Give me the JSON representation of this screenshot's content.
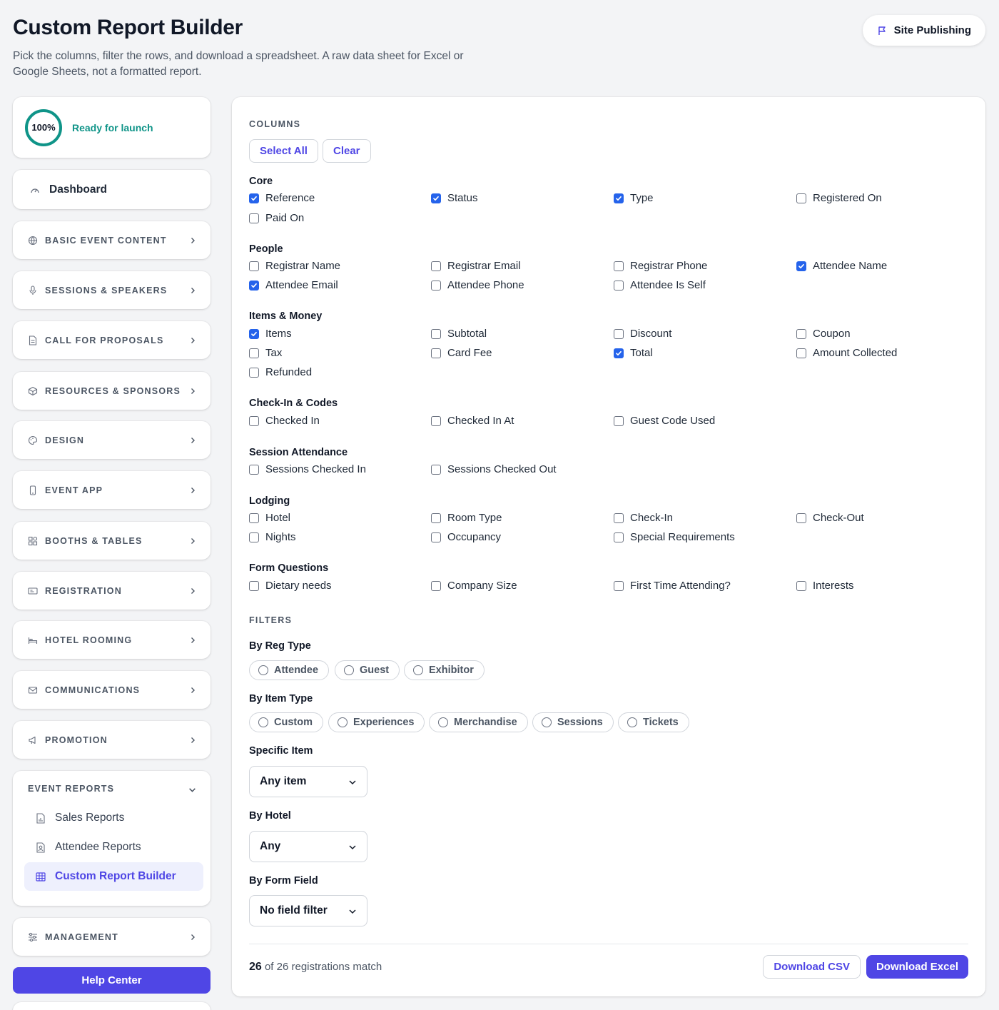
{
  "header": {
    "title": "Custom Report Builder",
    "subtitle": "Pick the columns, filter the rows, and download a spreadsheet. A raw data sheet for Excel or Google Sheets, not a formatted report.",
    "publish_label": "Site Publishing",
    "publish_icon": "flag-icon"
  },
  "sidebar": {
    "launch": {
      "percent": "100%",
      "status": "Ready for launch",
      "progress": 1.0,
      "color": "#0f9488"
    },
    "dashboard": {
      "label": "Dashboard",
      "icon": "gauge-icon"
    },
    "items": [
      {
        "label": "BASIC EVENT CONTENT",
        "icon": "globe-icon"
      },
      {
        "label": "SESSIONS & SPEAKERS",
        "icon": "microphone-icon"
      },
      {
        "label": "CALL FOR PROPOSALS",
        "icon": "document-icon"
      },
      {
        "label": "RESOURCES & SPONSORS",
        "icon": "box-icon"
      },
      {
        "label": "DESIGN",
        "icon": "palette-icon"
      },
      {
        "label": "EVENT APP",
        "icon": "phone-icon"
      },
      {
        "label": "BOOTHS & TABLES",
        "icon": "grid-icon"
      },
      {
        "label": "REGISTRATION",
        "icon": "ticket-icon"
      },
      {
        "label": "HOTEL ROOMING",
        "icon": "bed-icon"
      },
      {
        "label": "COMMUNICATIONS",
        "icon": "mail-icon"
      },
      {
        "label": "PROMOTION",
        "icon": "megaphone-icon"
      }
    ],
    "reports": {
      "label": "EVENT REPORTS",
      "sub": [
        {
          "label": "Sales Reports",
          "icon": "chart-file-icon",
          "active": false
        },
        {
          "label": "Attendee Reports",
          "icon": "person-file-icon",
          "active": false
        },
        {
          "label": "Custom Report Builder",
          "icon": "table-icon",
          "active": true
        }
      ]
    },
    "management": {
      "label": "MANAGEMENT",
      "icon": "sliders-icon"
    },
    "help_label": "Help Center"
  },
  "main": {
    "columns_label": "COLUMNS",
    "select_all": "Select All",
    "clear": "Clear",
    "groups": [
      {
        "title": "Core",
        "items": [
          {
            "label": "Reference",
            "checked": true
          },
          {
            "label": "Status",
            "checked": true
          },
          {
            "label": "Type",
            "checked": true
          },
          {
            "label": "Registered On",
            "checked": false
          },
          {
            "label": "Paid On",
            "checked": false
          }
        ]
      },
      {
        "title": "People",
        "items": [
          {
            "label": "Registrar Name",
            "checked": false
          },
          {
            "label": "Registrar Email",
            "checked": false
          },
          {
            "label": "Registrar Phone",
            "checked": false
          },
          {
            "label": "Attendee Name",
            "checked": true
          },
          {
            "label": "Attendee Email",
            "checked": true
          },
          {
            "label": "Attendee Phone",
            "checked": false
          },
          {
            "label": "Attendee Is Self",
            "checked": false
          }
        ]
      },
      {
        "title": "Items & Money",
        "items": [
          {
            "label": "Items",
            "checked": true
          },
          {
            "label": "Subtotal",
            "checked": false
          },
          {
            "label": "Discount",
            "checked": false
          },
          {
            "label": "Coupon",
            "checked": false
          },
          {
            "label": "Tax",
            "checked": false
          },
          {
            "label": "Card Fee",
            "checked": false
          },
          {
            "label": "Total",
            "checked": true
          },
          {
            "label": "Amount Collected",
            "checked": false
          },
          {
            "label": "Refunded",
            "checked": false
          }
        ]
      },
      {
        "title": "Check-In & Codes",
        "items": [
          {
            "label": "Checked In",
            "checked": false
          },
          {
            "label": "Checked In At",
            "checked": false
          },
          {
            "label": "Guest Code Used",
            "checked": false
          }
        ]
      },
      {
        "title": "Session Attendance",
        "items": [
          {
            "label": "Sessions Checked In",
            "checked": false
          },
          {
            "label": "Sessions Checked Out",
            "checked": false
          }
        ]
      },
      {
        "title": "Lodging",
        "items": [
          {
            "label": "Hotel",
            "checked": false
          },
          {
            "label": "Room Type",
            "checked": false
          },
          {
            "label": "Check-In",
            "checked": false
          },
          {
            "label": "Check-Out",
            "checked": false
          },
          {
            "label": "Nights",
            "checked": false
          },
          {
            "label": "Occupancy",
            "checked": false
          },
          {
            "label": "Special Requirements",
            "checked": false
          }
        ]
      },
      {
        "title": "Form Questions",
        "items": [
          {
            "label": "Dietary needs",
            "checked": false
          },
          {
            "label": "Company Size",
            "checked": false
          },
          {
            "label": "First Time Attending?",
            "checked": false
          },
          {
            "label": "Interests",
            "checked": false
          }
        ]
      }
    ],
    "filters_label": "FILTERS",
    "reg_type": {
      "title": "By Reg Type",
      "options": [
        "Attendee",
        "Guest",
        "Exhibitor"
      ]
    },
    "item_type": {
      "title": "By Item Type",
      "options": [
        "Custom",
        "Experiences",
        "Merchandise",
        "Sessions",
        "Tickets"
      ]
    },
    "specific_item": {
      "title": "Specific Item",
      "value": "Any item"
    },
    "by_hotel": {
      "title": "By Hotel",
      "value": "Any"
    },
    "by_form_field": {
      "title": "By Form Field",
      "value": "No field filter"
    },
    "footer": {
      "match_count": "26",
      "match_text": "of 26 registrations match",
      "download_csv": "Download CSV",
      "download_excel": "Download Excel"
    }
  },
  "colors": {
    "accent": "#4f46e5",
    "checkbox": "#2563eb",
    "teal": "#0f9488"
  }
}
